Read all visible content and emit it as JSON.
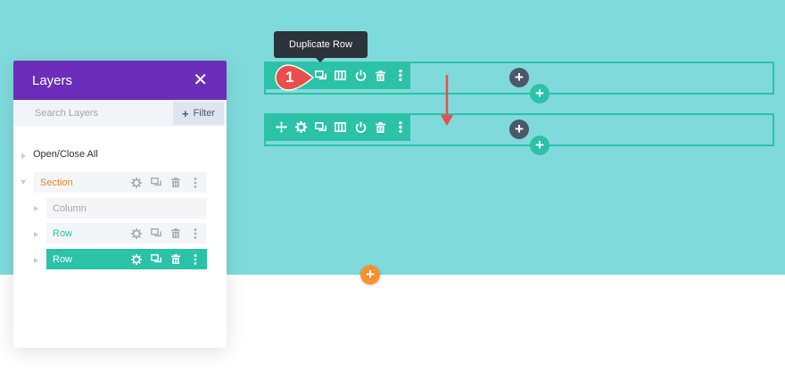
{
  "canvas": {
    "section_add_symbol": "+",
    "row_add_symbol": "+",
    "module_add_symbol": "+"
  },
  "tooltip": {
    "text": "Duplicate Row"
  },
  "step_badge": {
    "number": "1",
    "color": "#e84f4a"
  },
  "row_toolbar_icons": [
    "move-icon",
    "settings-icon",
    "duplicate-icon",
    "columns-icon",
    "power-icon",
    "trash-icon",
    "more-icon"
  ],
  "layers_panel": {
    "title": "Layers",
    "close_symbol": "✕",
    "search_placeholder": "Search Layers",
    "filter_label": "Filter",
    "filter_symbol": "+",
    "open_close_all": "Open/Close All",
    "nodes": [
      {
        "label": "Section",
        "color": "#f0821f"
      },
      {
        "label": "Column",
        "color": "#9aa6b2"
      },
      {
        "label": "Row",
        "color": "#2bc2a7"
      },
      {
        "label": "Row",
        "color": "#ffffff",
        "active": true
      }
    ]
  },
  "colors": {
    "section_bg": "#80dadc",
    "teal": "#2bc2a7",
    "purple": "#6c2eb9",
    "orange": "#f6922e",
    "dark": "#4c5866"
  }
}
